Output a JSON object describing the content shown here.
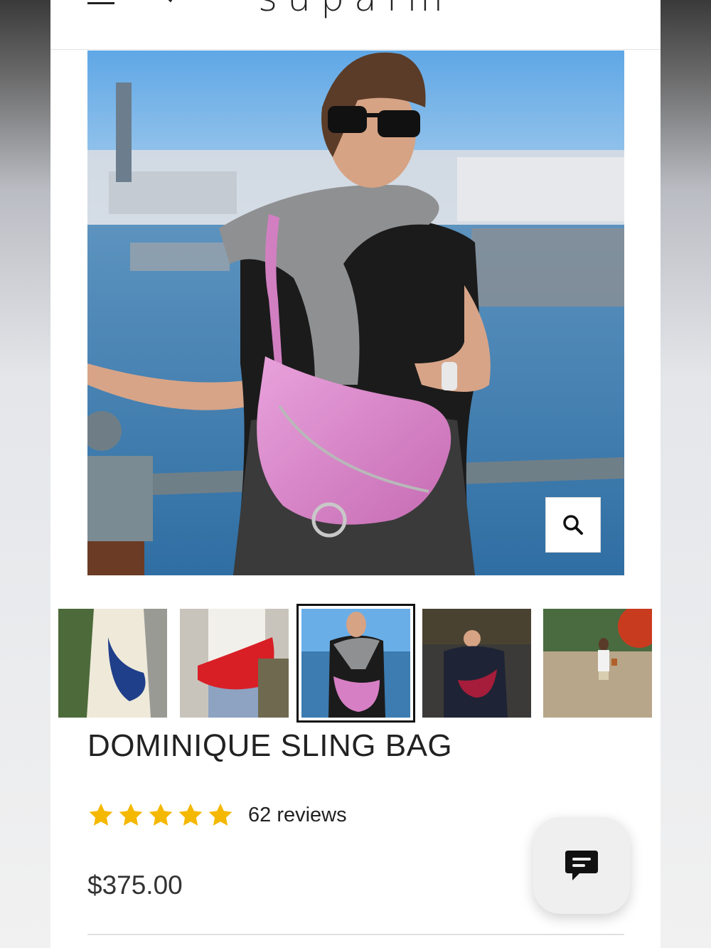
{
  "header": {
    "logo_text": "supalm",
    "menu_icon": "hamburger-menu-icon",
    "search_icon": "search-icon",
    "cart_icon": "shopping-bag-icon"
  },
  "gallery": {
    "main_image_alt": "Woman wearing pink sling bag by the harbor",
    "zoom_icon": "zoom-search-icon",
    "thumbnails": [
      {
        "alt": "Navy sling bag"
      },
      {
        "alt": "Red sling bag"
      },
      {
        "alt": "Pink sling bag"
      },
      {
        "alt": "Burgundy sling bag at night"
      },
      {
        "alt": "Tan sling bag in autumn park"
      }
    ],
    "active_thumbnail_index": 2
  },
  "product": {
    "title": "DOMINIQUE SLING BAG",
    "rating": 5,
    "reviews_label": "62 reviews",
    "price": "$375.00"
  },
  "colors": {
    "star": "#f5b800",
    "text": "#222222",
    "bag_pink": "#d77fc4"
  },
  "chat": {
    "icon": "chat-message-icon"
  }
}
